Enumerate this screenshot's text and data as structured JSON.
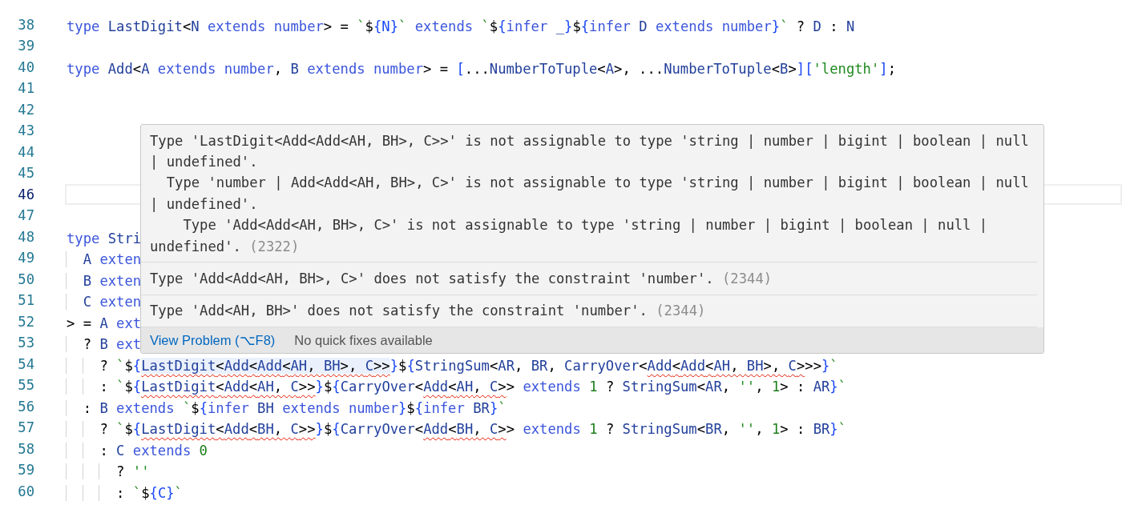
{
  "editor": {
    "lines": [
      {
        "number": "38",
        "current": false,
        "tokens": [
          {
            "kind": "keyword",
            "text": "type "
          },
          {
            "kind": "type",
            "text": "LastDigit"
          },
          {
            "kind": "punct",
            "text": "<"
          },
          {
            "kind": "type",
            "text": "N "
          },
          {
            "kind": "keyword",
            "text": "extends number"
          },
          {
            "kind": "punct",
            "text": "> = "
          },
          {
            "kind": "string",
            "text": "`"
          },
          {
            "kind": "punct",
            "text": "$"
          },
          {
            "kind": "brace",
            "text": "{N}"
          },
          {
            "kind": "string",
            "text": "`"
          },
          {
            "kind": "keyword",
            "text": " extends "
          },
          {
            "kind": "string",
            "text": "`"
          },
          {
            "kind": "punct",
            "text": "$"
          },
          {
            "kind": "brace",
            "text": "{"
          },
          {
            "kind": "keyword",
            "text": "infer "
          },
          {
            "kind": "type",
            "text": "_"
          },
          {
            "kind": "brace",
            "text": "}"
          },
          {
            "kind": "punct",
            "text": "$"
          },
          {
            "kind": "brace",
            "text": "{"
          },
          {
            "kind": "keyword",
            "text": "infer "
          },
          {
            "kind": "type",
            "text": "D "
          },
          {
            "kind": "keyword",
            "text": "extends number"
          },
          {
            "kind": "brace",
            "text": "}"
          },
          {
            "kind": "string",
            "text": "`"
          },
          {
            "kind": "punct",
            "text": " ? "
          },
          {
            "kind": "type",
            "text": "D"
          },
          {
            "kind": "punct",
            "text": " : "
          },
          {
            "kind": "type",
            "text": "N"
          }
        ]
      },
      {
        "number": "39",
        "current": false
      },
      {
        "number": "40",
        "current": false,
        "tokens": [
          {
            "kind": "keyword",
            "text": "type "
          },
          {
            "kind": "type",
            "text": "Add"
          },
          {
            "kind": "punct",
            "text": "<"
          },
          {
            "kind": "type",
            "text": "A "
          },
          {
            "kind": "keyword",
            "text": "extends number"
          },
          {
            "kind": "punct",
            "text": ", "
          },
          {
            "kind": "type",
            "text": "B "
          },
          {
            "kind": "keyword",
            "text": "extends number"
          },
          {
            "kind": "punct",
            "text": "> = "
          },
          {
            "kind": "brace",
            "text": "["
          },
          {
            "kind": "punct",
            "text": "..."
          },
          {
            "kind": "type",
            "text": "NumberToTuple"
          },
          {
            "kind": "punct",
            "text": "<"
          },
          {
            "kind": "type",
            "text": "A"
          },
          {
            "kind": "punct",
            "text": ">, ..."
          },
          {
            "kind": "type",
            "text": "NumberToTuple"
          },
          {
            "kind": "punct",
            "text": "<"
          },
          {
            "kind": "type",
            "text": "B"
          },
          {
            "kind": "punct",
            "text": ">"
          },
          {
            "kind": "brace",
            "text": "]["
          },
          {
            "kind": "string",
            "text": "'length'"
          },
          {
            "kind": "brace",
            "text": "]"
          },
          {
            "kind": "punct",
            "text": ";"
          }
        ]
      },
      {
        "number": "41",
        "current": false
      },
      {
        "number": "42",
        "current": false
      },
      {
        "number": "43",
        "current": false
      },
      {
        "number": "44",
        "current": false
      },
      {
        "number": "45",
        "current": false
      },
      {
        "number": "46",
        "current": true
      },
      {
        "number": "47",
        "current": false
      },
      {
        "number": "48",
        "current": false,
        "tokens": [
          {
            "kind": "keyword",
            "text": "type "
          },
          {
            "kind": "type",
            "text": "Stri"
          }
        ]
      },
      {
        "number": "49",
        "current": false,
        "tokens": [
          {
            "kind": "type",
            "text": "  A "
          },
          {
            "kind": "keyword",
            "text": "exten"
          }
        ]
      },
      {
        "number": "50",
        "current": false,
        "tokens": [
          {
            "kind": "type",
            "text": "  B "
          },
          {
            "kind": "keyword",
            "text": "exten"
          }
        ]
      },
      {
        "number": "51",
        "current": false,
        "tokens": [
          {
            "kind": "type",
            "text": "  C "
          },
          {
            "kind": "keyword",
            "text": "exten"
          }
        ]
      },
      {
        "number": "52",
        "current": false,
        "tokens": [
          {
            "kind": "punct",
            "text": "> = "
          },
          {
            "kind": "type",
            "text": "A "
          },
          {
            "kind": "keyword",
            "text": "ext"
          }
        ]
      },
      {
        "number": "53",
        "current": false,
        "tokens": [
          {
            "kind": "punct",
            "text": "  ? "
          },
          {
            "kind": "type",
            "text": "B "
          },
          {
            "kind": "keyword",
            "text": "ext"
          }
        ]
      },
      {
        "number": "54",
        "current": false,
        "tokens": [
          {
            "kind": "punct",
            "text": "    ? "
          },
          {
            "kind": "string",
            "text": "`"
          },
          {
            "kind": "punct",
            "text": "$"
          },
          {
            "kind": "brace",
            "text": "{"
          },
          {
            "kind": "squiggle",
            "highlighted": true,
            "tokens": [
              {
                "kind": "type",
                "text": "LastDigit"
              },
              {
                "kind": "punct",
                "text": "<"
              },
              {
                "kind": "type",
                "text": "Add"
              },
              {
                "kind": "punct",
                "text": "<"
              },
              {
                "kind": "type",
                "text": "Add"
              },
              {
                "kind": "punct",
                "text": "<"
              },
              {
                "kind": "type",
                "text": "AH"
              },
              {
                "kind": "punct",
                "text": ", "
              },
              {
                "kind": "type",
                "text": "BH"
              },
              {
                "kind": "punct",
                "text": ">, "
              },
              {
                "kind": "type",
                "text": "C"
              },
              {
                "kind": "punct",
                "text": ">>"
              }
            ]
          },
          {
            "kind": "brace",
            "text": "}"
          },
          {
            "kind": "punct",
            "text": "$"
          },
          {
            "kind": "brace",
            "text": "{"
          },
          {
            "kind": "type",
            "text": "StringSum"
          },
          {
            "kind": "punct",
            "text": "<"
          },
          {
            "kind": "type",
            "text": "AR"
          },
          {
            "kind": "punct",
            "text": ", "
          },
          {
            "kind": "type",
            "text": "BR"
          },
          {
            "kind": "punct",
            "text": ", "
          },
          {
            "kind": "type",
            "text": "CarryOver"
          },
          {
            "kind": "punct",
            "text": "<"
          },
          {
            "kind": "squiggle",
            "highlighted": false,
            "tokens": [
              {
                "kind": "type",
                "text": "Add"
              },
              {
                "kind": "punct",
                "text": "<"
              },
              {
                "kind": "type",
                "text": "Add"
              },
              {
                "kind": "punct",
                "text": "<"
              },
              {
                "kind": "type",
                "text": "AH"
              },
              {
                "kind": "punct",
                "text": ", "
              },
              {
                "kind": "type",
                "text": "BH"
              },
              {
                "kind": "punct",
                "text": ">, "
              },
              {
                "kind": "type",
                "text": "C"
              },
              {
                "kind": "punct",
                "text": ">"
              }
            ]
          },
          {
            "kind": "punct",
            "text": ">>"
          },
          {
            "kind": "brace",
            "text": "}"
          },
          {
            "kind": "string",
            "text": "`"
          }
        ]
      },
      {
        "number": "55",
        "current": false,
        "tokens": [
          {
            "kind": "punct",
            "text": "    : "
          },
          {
            "kind": "string",
            "text": "`"
          },
          {
            "kind": "punct",
            "text": "$"
          },
          {
            "kind": "brace",
            "text": "{"
          },
          {
            "kind": "squiggle",
            "highlighted": false,
            "tokens": [
              {
                "kind": "type",
                "text": "LastDigit"
              },
              {
                "kind": "punct",
                "text": "<"
              },
              {
                "kind": "type",
                "text": "Add"
              },
              {
                "kind": "punct",
                "text": "<"
              },
              {
                "kind": "type",
                "text": "AH"
              },
              {
                "kind": "punct",
                "text": ", "
              },
              {
                "kind": "type",
                "text": "C"
              },
              {
                "kind": "punct",
                "text": ">>"
              }
            ]
          },
          {
            "kind": "brace",
            "text": "}"
          },
          {
            "kind": "punct",
            "text": "$"
          },
          {
            "kind": "brace",
            "text": "{"
          },
          {
            "kind": "type",
            "text": "CarryOver"
          },
          {
            "kind": "punct",
            "text": "<"
          },
          {
            "kind": "squiggle",
            "highlighted": false,
            "tokens": [
              {
                "kind": "type",
                "text": "Add"
              },
              {
                "kind": "punct",
                "text": "<"
              },
              {
                "kind": "type",
                "text": "AH"
              },
              {
                "kind": "punct",
                "text": ", "
              },
              {
                "kind": "type",
                "text": "C"
              },
              {
                "kind": "punct",
                "text": ">"
              }
            ]
          },
          {
            "kind": "punct",
            "text": "> "
          },
          {
            "kind": "keyword",
            "text": "extends "
          },
          {
            "kind": "number",
            "text": "1"
          },
          {
            "kind": "punct",
            "text": " ? "
          },
          {
            "kind": "type",
            "text": "StringSum"
          },
          {
            "kind": "punct",
            "text": "<"
          },
          {
            "kind": "type",
            "text": "AR"
          },
          {
            "kind": "punct",
            "text": ", "
          },
          {
            "kind": "string",
            "text": "''"
          },
          {
            "kind": "punct",
            "text": ", "
          },
          {
            "kind": "number",
            "text": "1"
          },
          {
            "kind": "punct",
            "text": "> : "
          },
          {
            "kind": "type",
            "text": "AR"
          },
          {
            "kind": "brace",
            "text": "}"
          },
          {
            "kind": "string",
            "text": "`"
          }
        ]
      },
      {
        "number": "56",
        "current": false,
        "tokens": [
          {
            "kind": "punct",
            "text": "  : "
          },
          {
            "kind": "type",
            "text": "B "
          },
          {
            "kind": "keyword",
            "text": "extends "
          },
          {
            "kind": "string",
            "text": "`"
          },
          {
            "kind": "punct",
            "text": "$"
          },
          {
            "kind": "brace",
            "text": "{"
          },
          {
            "kind": "keyword",
            "text": "infer "
          },
          {
            "kind": "type",
            "text": "BH "
          },
          {
            "kind": "keyword",
            "text": "extends number"
          },
          {
            "kind": "brace",
            "text": "}"
          },
          {
            "kind": "punct",
            "text": "$"
          },
          {
            "kind": "brace",
            "text": "{"
          },
          {
            "kind": "keyword",
            "text": "infer "
          },
          {
            "kind": "type",
            "text": "BR"
          },
          {
            "kind": "brace",
            "text": "}"
          },
          {
            "kind": "string",
            "text": "`"
          }
        ]
      },
      {
        "number": "57",
        "current": false,
        "tokens": [
          {
            "kind": "punct",
            "text": "    ? "
          },
          {
            "kind": "string",
            "text": "`"
          },
          {
            "kind": "punct",
            "text": "$"
          },
          {
            "kind": "brace",
            "text": "{"
          },
          {
            "kind": "squiggle",
            "highlighted": false,
            "tokens": [
              {
                "kind": "type",
                "text": "LastDigit"
              },
              {
                "kind": "punct",
                "text": "<"
              },
              {
                "kind": "type",
                "text": "Add"
              },
              {
                "kind": "punct",
                "text": "<"
              },
              {
                "kind": "type",
                "text": "BH"
              },
              {
                "kind": "punct",
                "text": ", "
              },
              {
                "kind": "type",
                "text": "C"
              },
              {
                "kind": "punct",
                "text": ">>"
              }
            ]
          },
          {
            "kind": "brace",
            "text": "}"
          },
          {
            "kind": "punct",
            "text": "$"
          },
          {
            "kind": "brace",
            "text": "{"
          },
          {
            "kind": "type",
            "text": "CarryOver"
          },
          {
            "kind": "punct",
            "text": "<"
          },
          {
            "kind": "squiggle",
            "highlighted": false,
            "tokens": [
              {
                "kind": "type",
                "text": "Add"
              },
              {
                "kind": "punct",
                "text": "<"
              },
              {
                "kind": "type",
                "text": "BH"
              },
              {
                "kind": "punct",
                "text": ", "
              },
              {
                "kind": "type",
                "text": "C"
              },
              {
                "kind": "punct",
                "text": ">"
              }
            ]
          },
          {
            "kind": "punct",
            "text": "> "
          },
          {
            "kind": "keyword",
            "text": "extends "
          },
          {
            "kind": "number",
            "text": "1"
          },
          {
            "kind": "punct",
            "text": " ? "
          },
          {
            "kind": "type",
            "text": "StringSum"
          },
          {
            "kind": "punct",
            "text": "<"
          },
          {
            "kind": "type",
            "text": "BR"
          },
          {
            "kind": "punct",
            "text": ", "
          },
          {
            "kind": "string",
            "text": "''"
          },
          {
            "kind": "punct",
            "text": ", "
          },
          {
            "kind": "number",
            "text": "1"
          },
          {
            "kind": "punct",
            "text": "> : "
          },
          {
            "kind": "type",
            "text": "BR"
          },
          {
            "kind": "brace",
            "text": "}"
          },
          {
            "kind": "string",
            "text": "`"
          }
        ]
      },
      {
        "number": "58",
        "current": false,
        "tokens": [
          {
            "kind": "punct",
            "text": "    : "
          },
          {
            "kind": "type",
            "text": "C "
          },
          {
            "kind": "keyword",
            "text": "extends "
          },
          {
            "kind": "number",
            "text": "0"
          }
        ]
      },
      {
        "number": "59",
        "current": false,
        "tokens": [
          {
            "kind": "punct",
            "text": "      ? "
          },
          {
            "kind": "string",
            "text": "''"
          }
        ]
      },
      {
        "number": "60",
        "current": false,
        "tokens": [
          {
            "kind": "punct",
            "text": "      : "
          },
          {
            "kind": "string",
            "text": "`"
          },
          {
            "kind": "punct",
            "text": "$"
          },
          {
            "kind": "brace",
            "text": "{C}"
          },
          {
            "kind": "string",
            "text": "`"
          }
        ]
      }
    ]
  },
  "popup": {
    "messages": [
      {
        "text": "Type 'LastDigit<Add<Add<AH, BH>, C>>' is not assignable to type 'string | number | bigint | boolean | null | undefined'.\n  Type 'number | Add<Add<AH, BH>, C>' is not assignable to type 'string | number | bigint | boolean | null | undefined'.\n    Type 'Add<Add<AH, BH>, C>' is not assignable to type 'string | number | bigint | boolean | null | undefined'.",
        "code": "(2322)"
      },
      {
        "text": "Type 'Add<Add<AH, BH>, C>' does not satisfy the constraint 'number'.",
        "code": "(2344)"
      },
      {
        "text": "Type 'Add<AH, BH>' does not satisfy the constraint 'number'.",
        "code": "(2344)"
      }
    ],
    "action": "View Problem (⌥F8)",
    "status": "No quick fixes available"
  }
}
